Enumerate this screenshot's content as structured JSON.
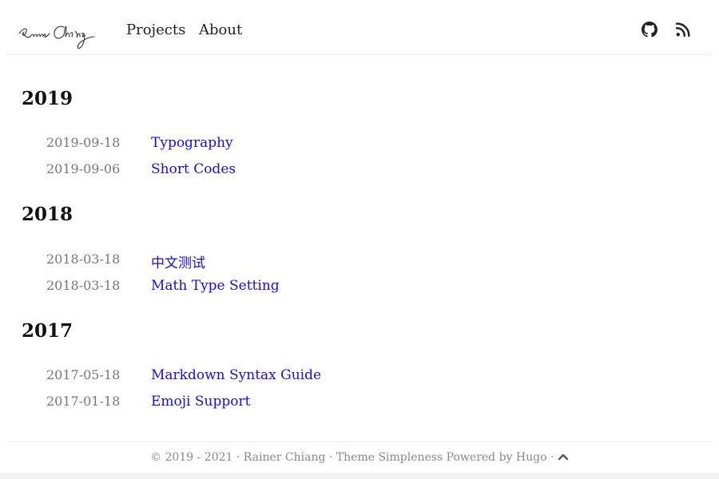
{
  "header": {
    "logo_text": "Rainer Chiang",
    "nav": [
      {
        "label": "Projects"
      },
      {
        "label": "About"
      }
    ],
    "icons": [
      "github-icon",
      "rss-icon"
    ]
  },
  "archive": [
    {
      "year": "2019",
      "posts": [
        {
          "date": "2019-09-18",
          "title": "Typography"
        },
        {
          "date": "2019-09-06",
          "title": "Short Codes"
        }
      ]
    },
    {
      "year": "2018",
      "posts": [
        {
          "date": "2018-03-18",
          "title": "中文测试"
        },
        {
          "date": "2018-03-18",
          "title": "Math Type Setting"
        }
      ]
    },
    {
      "year": "2017",
      "posts": [
        {
          "date": "2017-05-18",
          "title": "Markdown Syntax Guide"
        },
        {
          "date": "2017-01-18",
          "title": "Emoji Support"
        }
      ]
    }
  ],
  "footer": {
    "copyright": "© 2019 - 2021 · ",
    "author": "Rainer Chiang",
    "sep1": " · ",
    "theme": "Theme Simpleness",
    "powered": " Powered by ",
    "hugo": "Hugo",
    "sep2": " · "
  },
  "colors": {
    "link": "#1a0dd8",
    "date": "#777777",
    "footer": "#888888",
    "background": "#f2f2f2"
  }
}
